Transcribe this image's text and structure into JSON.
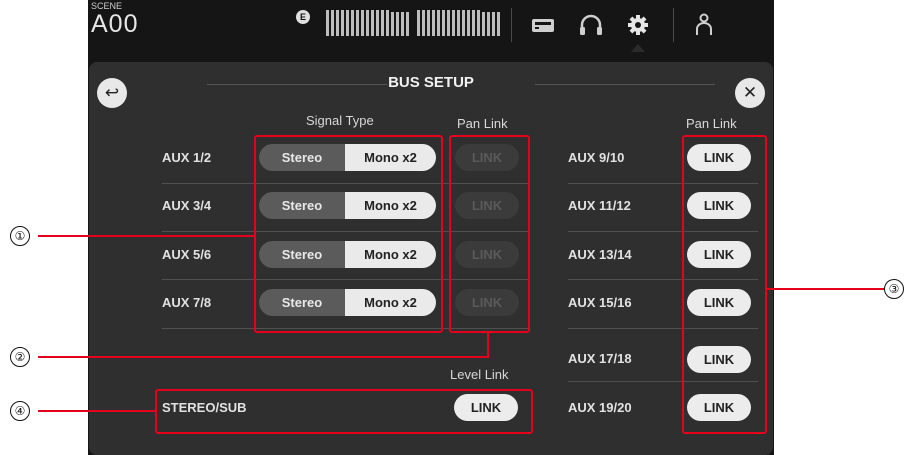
{
  "topbar": {
    "scene_label": "SCENE",
    "scene_name": "A00",
    "edit_badge": "E",
    "icons": [
      "meter-strip",
      "memory-card-icon",
      "headphones-icon",
      "gear-icon",
      "user-icon"
    ],
    "active_icon": "gear-icon"
  },
  "dialog": {
    "title": "BUS SETUP",
    "back_icon": "↩",
    "close_icon": "✕",
    "left_section": {
      "signal_type_header": "Signal Type",
      "pan_link_header": "Pan Link",
      "rows": [
        {
          "label": "AUX 1/2",
          "stereo": "Stereo",
          "mono": "Mono x2",
          "selected": "Mono x2",
          "link": "LINK",
          "link_enabled": false
        },
        {
          "label": "AUX 3/4",
          "stereo": "Stereo",
          "mono": "Mono x2",
          "selected": "Mono x2",
          "link": "LINK",
          "link_enabled": false
        },
        {
          "label": "AUX 5/6",
          "stereo": "Stereo",
          "mono": "Mono x2",
          "selected": "Mono x2",
          "link": "LINK",
          "link_enabled": false
        },
        {
          "label": "AUX 7/8",
          "stereo": "Stereo",
          "mono": "Mono x2",
          "selected": "Mono x2",
          "link": "LINK",
          "link_enabled": false
        }
      ]
    },
    "level_section": {
      "header": "Level Link",
      "label": "STEREO/SUB",
      "link": "LINK"
    },
    "right_section": {
      "pan_link_header": "Pan Link",
      "rows": [
        {
          "label": "AUX 9/10",
          "link": "LINK"
        },
        {
          "label": "AUX 11/12",
          "link": "LINK"
        },
        {
          "label": "AUX 13/14",
          "link": "LINK"
        },
        {
          "label": "AUX 15/16",
          "link": "LINK"
        },
        {
          "label": "AUX 17/18",
          "link": "LINK"
        },
        {
          "label": "AUX 19/20",
          "link": "LINK"
        }
      ]
    }
  },
  "callouts": {
    "c1": "①",
    "c2": "②",
    "c3": "③",
    "c4": "④"
  },
  "colors": {
    "callout_red": "#e5001b",
    "panel_bg": "#2f2f2f",
    "frame_bg": "#151515"
  }
}
